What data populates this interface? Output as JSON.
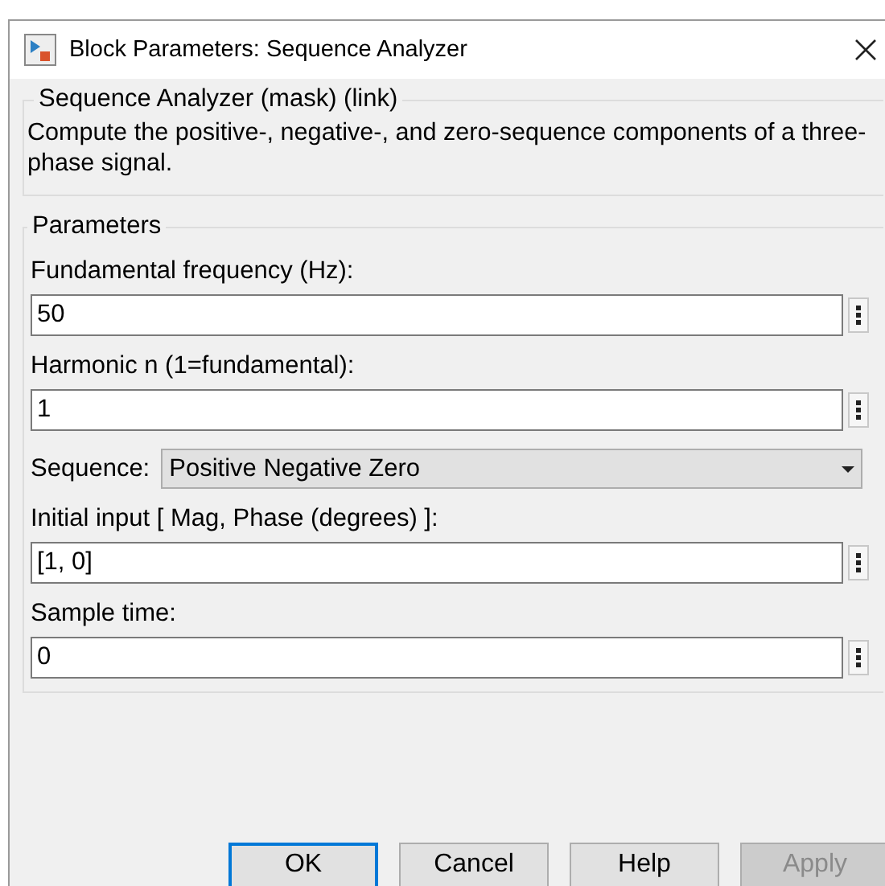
{
  "window": {
    "title": "Block Parameters: Sequence Analyzer"
  },
  "description_group": {
    "title": "Sequence Analyzer (mask) (link)",
    "text": "Compute the positive-, negative-, and zero-sequence components of a three-phase signal."
  },
  "parameters": {
    "title": "Parameters",
    "fields": [
      {
        "kind": "text",
        "label": "Fundamental frequency (Hz):",
        "value": "50"
      },
      {
        "kind": "text",
        "label": "Harmonic n (1=fundamental):",
        "value": "1"
      },
      {
        "kind": "dropdown",
        "label": "Sequence:",
        "value": "Positive Negative Zero"
      },
      {
        "kind": "text",
        "label": "Initial input [ Mag, Phase (degrees) ]:",
        "value": "[1, 0]"
      },
      {
        "kind": "text",
        "label": "Sample time:",
        "value": "0"
      }
    ]
  },
  "buttons": [
    {
      "label": "OK",
      "default": true,
      "disabled": false
    },
    {
      "label": "Cancel",
      "default": false,
      "disabled": false
    },
    {
      "label": "Help",
      "default": false,
      "disabled": false
    },
    {
      "label": "Apply",
      "default": false,
      "disabled": true
    }
  ]
}
